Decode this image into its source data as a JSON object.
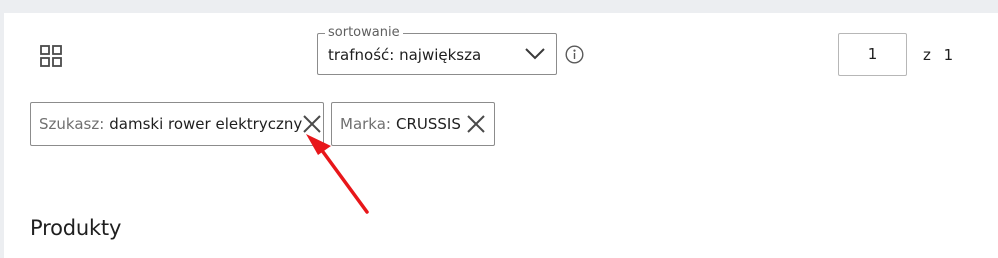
{
  "toolbar": {
    "grid_icon": "grid-view-icon",
    "sort": {
      "legend": "sortowanie",
      "value": "trafność: największa",
      "chevron_icon": "chevron-down-icon"
    },
    "info_icon": "info-icon",
    "pagination": {
      "current_page": "1",
      "separator": "z",
      "total_pages": "1"
    }
  },
  "filters": [
    {
      "label": "Szukasz:",
      "value": "damski rower elektryczny",
      "close_icon": "close-icon"
    },
    {
      "label": "Marka:",
      "value": "CRUSSIS",
      "close_icon": "close-icon"
    }
  ],
  "annotation": {
    "arrow_color": "#e8161a"
  },
  "section": {
    "heading": "Produkty"
  },
  "colors": {
    "page_background": "#eceef1",
    "panel_background": "#ffffff",
    "border": "#8c8c8c",
    "label_gray": "#707070",
    "text": "#1f1f1f"
  }
}
